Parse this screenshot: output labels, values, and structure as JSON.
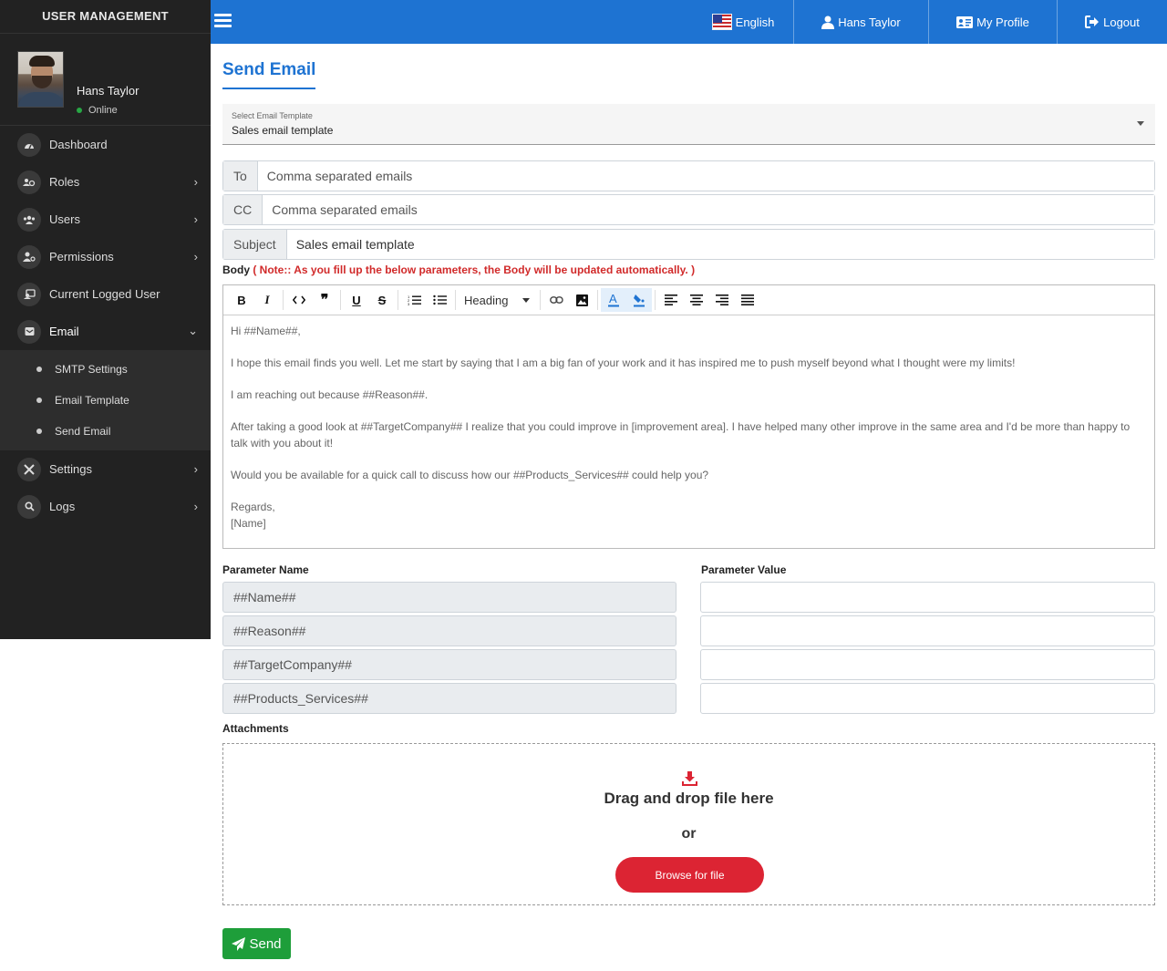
{
  "sidebar": {
    "brand": "USER MANAGEMENT",
    "user": {
      "name": "Hans Taylor",
      "status": "Online"
    },
    "items": [
      {
        "label": "Dashboard",
        "icon": "dashboard-icon"
      },
      {
        "label": "Roles",
        "icon": "roles-icon"
      },
      {
        "label": "Users",
        "icon": "users-icon"
      },
      {
        "label": "Permissions",
        "icon": "permissions-icon"
      },
      {
        "label": "Current Logged User",
        "icon": "logged-user-icon"
      },
      {
        "label": "Email",
        "icon": "email-icon"
      },
      {
        "label": "Settings",
        "icon": "settings-icon"
      },
      {
        "label": "Logs",
        "icon": "search-icon"
      }
    ],
    "email_submenu": [
      "SMTP Settings",
      "Email Template",
      "Send Email"
    ]
  },
  "topbar": {
    "language": "English",
    "user": "Hans Taylor",
    "profile": "My Profile",
    "logout": "Logout"
  },
  "page": {
    "title": "Send Email",
    "template_select": {
      "label": "Select Email Template",
      "value": "Sales email template"
    },
    "to": {
      "label": "To",
      "placeholder": "Comma separated emails"
    },
    "cc": {
      "label": "CC",
      "placeholder": "Comma separated emails"
    },
    "subject": {
      "label": "Subject",
      "value": "Sales email template"
    },
    "body_label": "Body",
    "body_note": "( Note:: As you fill up the below parameters, the Body will be updated automatically. )",
    "toolbar": {
      "heading": "Heading"
    },
    "body_paragraphs": [
      "Hi ##Name##,",
      "I hope this email finds you well. Let me start by saying that I am a big fan of your work and it has inspired me to push myself beyond what I thought were my limits!",
      "I am reaching out because ##Reason##.",
      "After taking a good look at ##TargetCompany## I realize that you could improve in [improvement area]. I have helped many other improve in the same area and I'd be more than happy to talk with you about it!",
      "Would you be available for a quick call to discuss how our ##Products_Services## could help you?",
      "Regards,",
      "[Name]"
    ],
    "param_name_header": "Parameter Name",
    "param_value_header": "Parameter Value",
    "parameters": [
      "##Name##",
      "##Reason##",
      "##TargetCompany##",
      "##Products_Services##"
    ],
    "attachments_label": "Attachments",
    "dropzone_title": "Drag and drop file here",
    "dropzone_or": "or",
    "browse_label": "Browse for file",
    "send_label": "Send"
  },
  "colors": {
    "primary": "#1e73d2",
    "sidebar": "#222222",
    "danger": "#dc2433",
    "success": "#1e9e3a",
    "note": "#d12a2a"
  }
}
